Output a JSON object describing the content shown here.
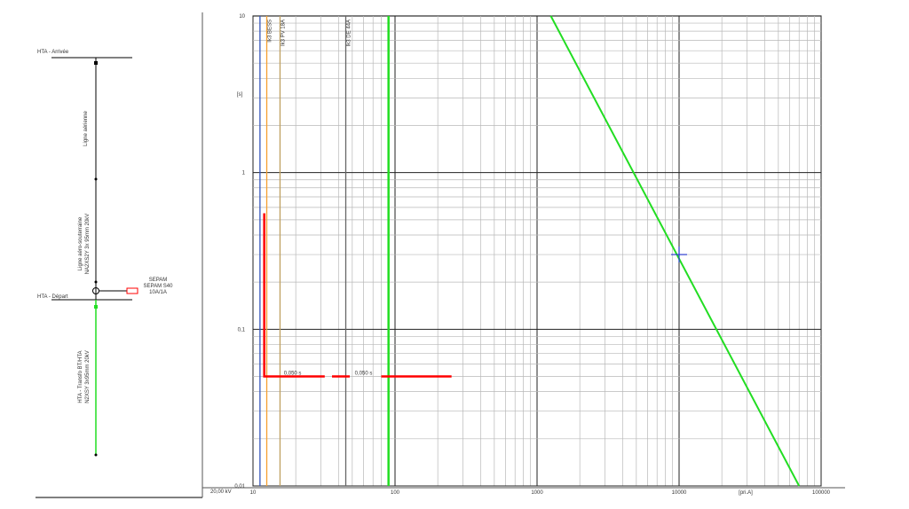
{
  "one_line": {
    "busbars": [
      {
        "label": "HTA - Arrivée"
      },
      {
        "label": "HTA - Départ"
      }
    ],
    "cable_labels": [
      {
        "text": "Ligne aérienne",
        "color": "#000000"
      },
      {
        "text": "Ligne aéro-souterraine",
        "color": "#000000"
      },
      {
        "text": "NA2XS2Y 3x 95mm 20kV",
        "color": "#000000"
      },
      {
        "text": "HTA - Transfo BT/HTA",
        "color": "#22dd22"
      },
      {
        "text": "N2XSY 3x95mm 20kV",
        "color": "#22dd22"
      }
    ],
    "relay_label": [
      "SEPAM",
      "SEPAM S40",
      "10A/1A"
    ],
    "relay_color": "#ff0000",
    "voltage_label": "20,00 kV"
  },
  "chart_data": {
    "type": "line",
    "x_scale": "log",
    "y_scale": "log",
    "xlim": [
      10,
      100000
    ],
    "ylim": [
      0.01,
      10
    ],
    "x_ticks": [
      "10",
      "100",
      "1000",
      "10000",
      "100000"
    ],
    "y_ticks": [
      "10",
      "1",
      "0,1",
      "0,01"
    ],
    "xlabel": "[pri.A]",
    "ylabel": "[s]",
    "vertical_markers": [
      {
        "name": "Ik3 BESS",
        "x": 12.5,
        "color": "#f5a030"
      },
      {
        "name": "Ik3 PV 18A",
        "x": 15.5,
        "color": "#bfa060"
      },
      {
        "name": "Ik3 DE 44A",
        "x": 45,
        "color": "#666666"
      },
      {
        "name": "",
        "x": 11.2,
        "color": "#3355bb"
      },
      {
        "name": "",
        "x": 90,
        "color": "#22dd22",
        "width": 2.5
      }
    ],
    "series": [
      {
        "name": "",
        "color": "#22dd22",
        "points": [
          [
            1250,
            10
          ],
          [
            70000,
            0.01
          ]
        ]
      },
      {
        "name": "",
        "color": "#ff0000",
        "points": [
          [
            12,
            0.55
          ],
          [
            12,
            0.05
          ],
          [
            32,
            0.05
          ]
        ]
      },
      {
        "name": "",
        "color": "#ff0000",
        "points": [
          [
            36,
            0.05
          ],
          [
            48,
            0.05
          ]
        ]
      },
      {
        "name": "",
        "color": "#ff0000",
        "points": [
          [
            80,
            0.05
          ],
          [
            250,
            0.05
          ]
        ]
      }
    ],
    "annotations": [
      {
        "text": "Ik3 BESS",
        "x": 12.5
      },
      {
        "text": "Ik3 PV 18A",
        "x": 15.5
      },
      {
        "text": "Ik3 DE 44A",
        "x": 45
      }
    ],
    "time_labels": [
      {
        "text": "0,050 s",
        "x": 19,
        "y": 0.05
      },
      {
        "text": "0,050 s",
        "x": 60,
        "y": 0.05
      }
    ],
    "cross_marker": {
      "x": 10000,
      "y": 0.3,
      "color": "#2233cc"
    }
  }
}
